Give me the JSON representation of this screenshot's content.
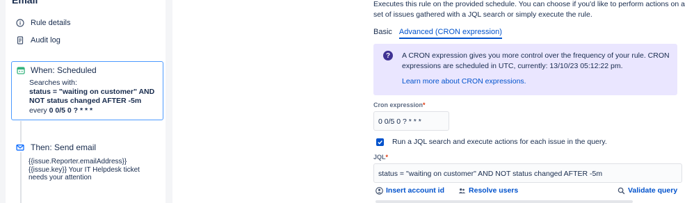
{
  "left": {
    "section_title": "Email",
    "menu": [
      {
        "label": "Rule details",
        "icon": "info-circle-icon"
      },
      {
        "label": "Audit log",
        "icon": "document-icon"
      }
    ],
    "trigger": {
      "title": "When: Scheduled",
      "searches_with": "Searches with:",
      "query": "status = \"waiting on customer\" AND NOT status changed AFTER -5m",
      "every_prefix": "every ",
      "cron": "0 0/5 0 ? * * *",
      "icon": "calendar-icon"
    },
    "action": {
      "title": "Then: Send email",
      "line1": "{{issue.Reporter.emailAddress}}",
      "line2": "{{issue.key}} Your IT Helpdesk ticket needs your attention",
      "icon": "envelope-icon"
    }
  },
  "right": {
    "description": "Executes this rule on the provided schedule. You can choose if you'd like to perform actions on a set of issues gathered with a JQL search or simply execute the rule.",
    "tabs": [
      {
        "label": "Basic",
        "active": false
      },
      {
        "label": "Advanced (CRON expression)",
        "active": true
      }
    ],
    "info": {
      "text": "A CRON expression gives you more control over the frequency of your rule. CRON expressions are scheduled in UTC, currently: 13/10/23 05:12:22 pm.",
      "link": "Learn more about CRON expressions."
    },
    "cron_label": "Cron expression",
    "cron_value": "0 0/5 0 ? * * *",
    "checkbox_label": "Run a JQL search and execute actions for each issue in the query.",
    "checkbox_checked": true,
    "jql_label": "JQL",
    "required_mark": "*",
    "jql_value": "status = \"waiting on customer\" AND NOT status changed AFTER -5m",
    "actions": {
      "insert_account": "Insert account id",
      "resolve_users": "Resolve users",
      "validate_query": "Validate query"
    }
  },
  "colors": {
    "accent": "#0052cc",
    "info_bg": "#eae6ff",
    "info_icon": "#403294",
    "required": "#de350b",
    "selected_border": "#4c9aff"
  }
}
